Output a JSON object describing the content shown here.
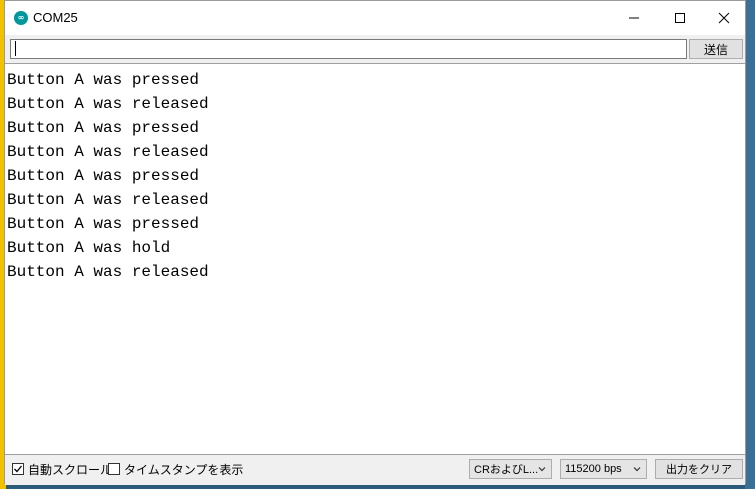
{
  "window": {
    "title": "COM25",
    "icon": "arduino-icon",
    "controls": [
      "minimize-icon",
      "maximize-icon",
      "close-icon"
    ]
  },
  "input": {
    "value": "",
    "send_label": "送信"
  },
  "output": {
    "lines": [
      "Button A was pressed",
      "Button A was released",
      "Button A was pressed",
      "Button A was released",
      "Button A was pressed",
      "Button A was released",
      "Button A was pressed",
      "Button A was hold",
      "Button A was released"
    ]
  },
  "statusbar": {
    "autoscroll_label": "自動スクロール",
    "autoscroll_checked": true,
    "timestamp_label": "タイムスタンプを表示",
    "timestamp_checked": false,
    "line_ending": "CRおよびL...",
    "baud_rate": "115200 bps",
    "clear_label": "出力をクリア"
  },
  "colors": {
    "accent": "#00979c",
    "window_bg": "#f0f0f0"
  }
}
